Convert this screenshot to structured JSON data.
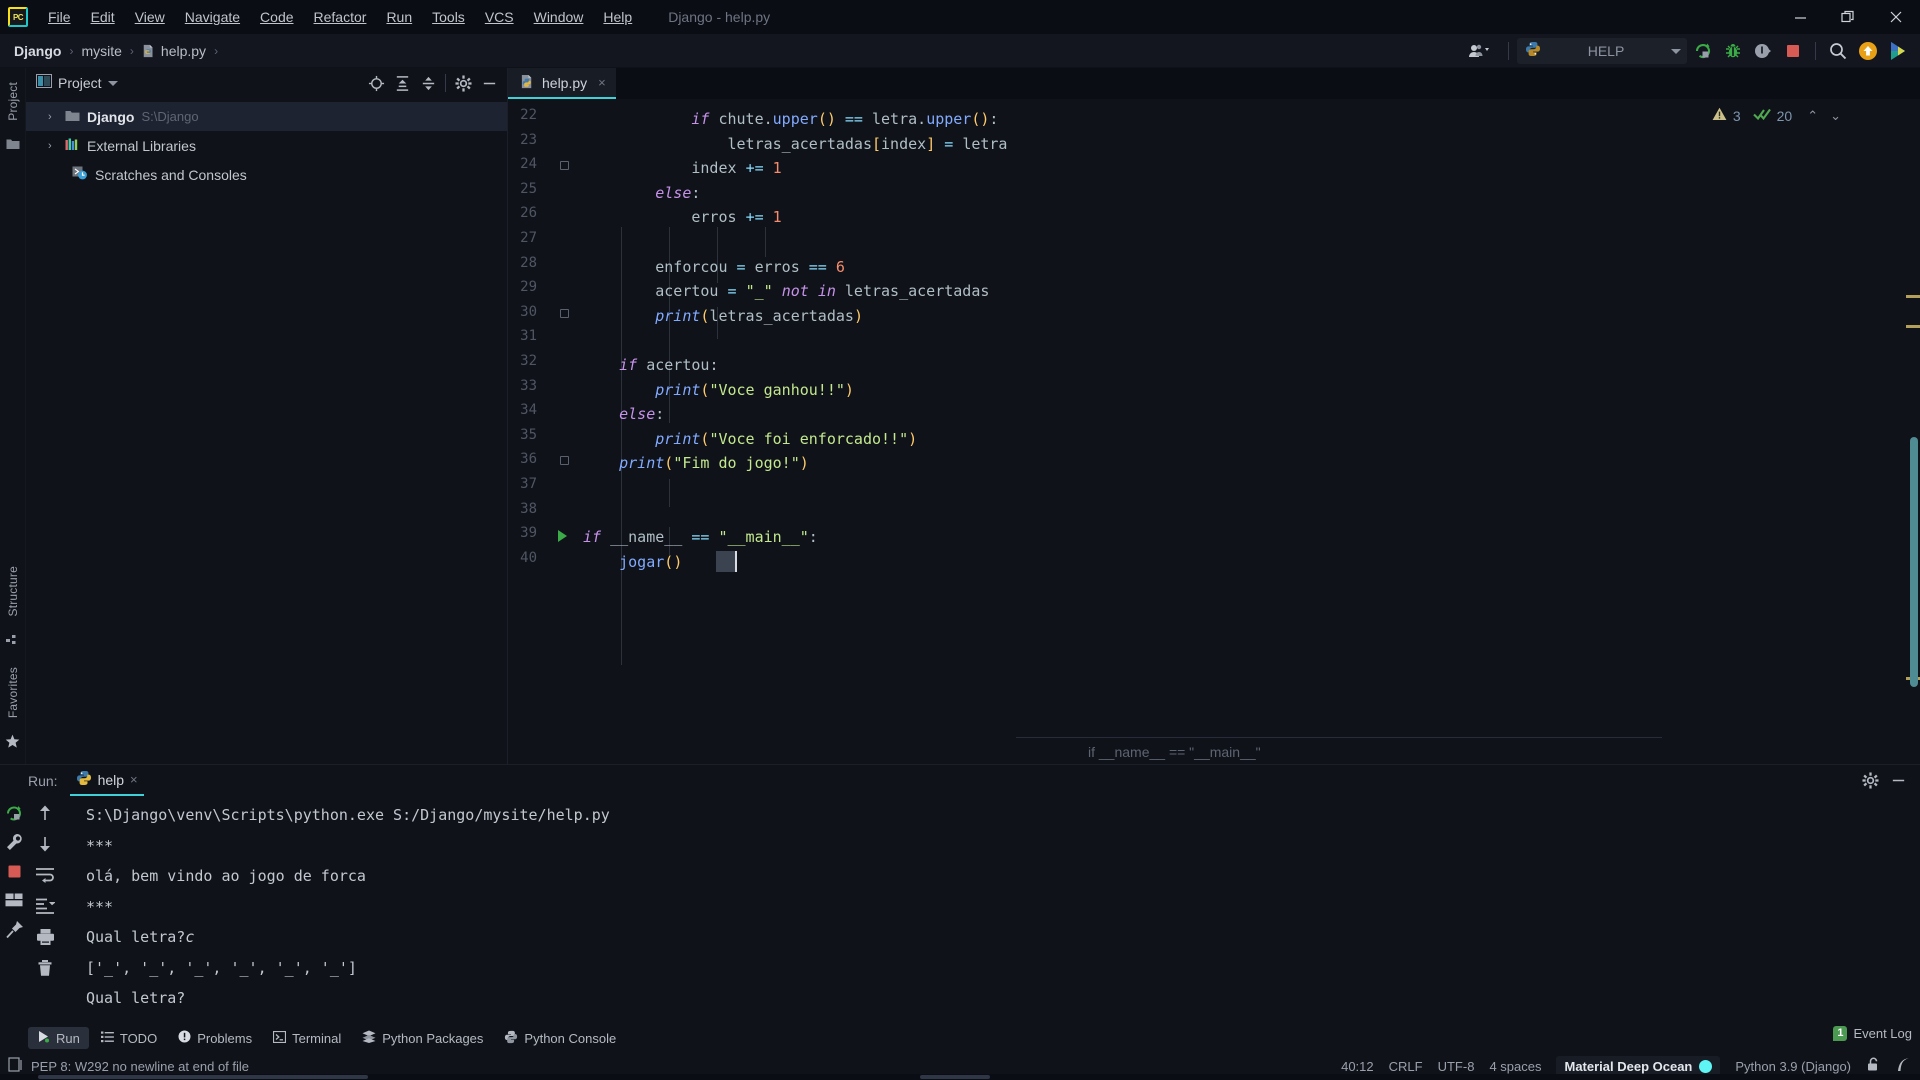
{
  "window": {
    "title": "Django - help.py",
    "controls": {
      "minimize": "minimize-icon",
      "restore": "restore-icon",
      "close": "close-icon"
    }
  },
  "menu": {
    "items": [
      {
        "label": "File"
      },
      {
        "label": "Edit"
      },
      {
        "label": "View"
      },
      {
        "label": "Navigate"
      },
      {
        "label": "Code"
      },
      {
        "label": "Refactor"
      },
      {
        "label": "Run"
      },
      {
        "label": "Tools"
      },
      {
        "label": "VCS"
      },
      {
        "label": "Window"
      },
      {
        "label": "Help"
      }
    ]
  },
  "navbar": {
    "breadcrumbs": [
      {
        "label": "Django",
        "icon": ""
      },
      {
        "label": "mysite",
        "icon": ""
      },
      {
        "label": "help.py",
        "icon": "python-file-icon"
      }
    ],
    "separator": "›",
    "run_config": {
      "label": "HELP",
      "icon": "python-icon"
    },
    "buttons": [
      {
        "name": "user-accounts-icon",
        "tip": "Accounts"
      },
      {
        "name": "run-button",
        "tip": "Run"
      },
      {
        "name": "debug-button",
        "tip": "Debug"
      },
      {
        "name": "run-with-coverage-button",
        "tip": "Run with Coverage"
      },
      {
        "name": "stop-button",
        "tip": "Stop"
      },
      {
        "name": "search-everywhere-icon",
        "tip": "Search Everywhere"
      },
      {
        "name": "update-project-icon",
        "tip": "Update"
      },
      {
        "name": "ide-assistant-icon",
        "tip": "Assistant"
      }
    ]
  },
  "project_panel": {
    "title": "Project",
    "toolbar_icons": [
      "locate-icon",
      "expand-all-icon",
      "collapse-all-icon",
      "gear-icon",
      "hide-icon"
    ],
    "tree": [
      {
        "label": "Django",
        "path": "S:\\Django",
        "arrow": "›",
        "icon": "folder-icon",
        "bold": true,
        "selected": true
      },
      {
        "label": "External Libraries",
        "path": "",
        "arrow": "›",
        "icon": "libraries-icon",
        "bold": false,
        "selected": false
      },
      {
        "label": "Scratches and Consoles",
        "path": "",
        "arrow": "",
        "icon": "scratches-icon",
        "bold": false,
        "selected": false
      }
    ]
  },
  "left_rail": {
    "labels": [
      "Project"
    ]
  },
  "bottom_left_rail": {
    "labels": [
      "Structure",
      "Favorites"
    ]
  },
  "editor": {
    "tab": {
      "label": "help.py",
      "close": "×",
      "icon": "python-file-icon"
    },
    "inspections": {
      "warning_count": "3",
      "ok_count": "20",
      "warning_icon": "warning-triangle-icon",
      "ok_icon": "double-check-icon",
      "prev": "⌃",
      "next": "⌄"
    },
    "bottom_breadcrumb": "if __name__ == \"__main__\"",
    "lines": [
      {
        "n": "22",
        "text": "            if chute.upper() == letra.upper():"
      },
      {
        "n": "23",
        "text": "                letras_acertadas[index] = letra"
      },
      {
        "n": "24",
        "text": "            index += 1"
      },
      {
        "n": "25",
        "text": "        else:"
      },
      {
        "n": "26",
        "text": "            erros += 1"
      },
      {
        "n": "27",
        "text": ""
      },
      {
        "n": "28",
        "text": "        enforcou = erros == 6"
      },
      {
        "n": "29",
        "text": "        acertou = \"_\" not in letras_acertadas"
      },
      {
        "n": "30",
        "text": "        print(letras_acertadas)"
      },
      {
        "n": "31",
        "text": ""
      },
      {
        "n": "32",
        "text": "    if acertou:"
      },
      {
        "n": "33",
        "text": "        print(\"Voce ganhou!!\")"
      },
      {
        "n": "34",
        "text": "    else:"
      },
      {
        "n": "35",
        "text": "        print(\"Voce foi enforcado!!\")"
      },
      {
        "n": "36",
        "text": "    print(\"Fim do jogo!\")"
      },
      {
        "n": "37",
        "text": ""
      },
      {
        "n": "38",
        "text": ""
      },
      {
        "n": "39",
        "text": "if __name__ == \"__main__\":"
      },
      {
        "n": "40",
        "text": "    jogar()"
      }
    ]
  },
  "run_panel": {
    "label": "Run:",
    "tab": {
      "label": "help",
      "close": "×",
      "icon": "python-icon"
    },
    "head_icons": [
      "gear-icon",
      "hide-icon"
    ],
    "left_tools": [
      "rerun-icon",
      "settings-wrench-icon",
      "stop-icon",
      "layout-icon",
      "pin-icon"
    ],
    "right_tools": [
      "up-arrow-icon",
      "down-arrow-icon",
      "soft-wrap-icon",
      "scroll-to-end-icon",
      "print-icon",
      "trash-icon"
    ],
    "console_lines": [
      {
        "text": "S:\\Django\\venv\\Scripts\\python.exe S:/Django/mysite/help.py",
        "input": ""
      },
      {
        "text": "***",
        "input": ""
      },
      {
        "text": "olá, bem vindo ao jogo de forca",
        "input": ""
      },
      {
        "text": "***",
        "input": ""
      },
      {
        "text": "Qual letra?",
        "input": "c"
      },
      {
        "text": "['_', '_', '_', '_', '_', '_']",
        "input": ""
      },
      {
        "text": "Qual letra?",
        "input": ""
      }
    ]
  },
  "tool_windows": [
    {
      "label": "Run",
      "icon": "run-icon",
      "active": true
    },
    {
      "label": "TODO",
      "icon": "todo-icon",
      "active": false
    },
    {
      "label": "Problems",
      "icon": "problems-icon",
      "active": false
    },
    {
      "label": "Terminal",
      "icon": "terminal-icon",
      "active": false
    },
    {
      "label": "Python Packages",
      "icon": "packages-icon",
      "active": false
    },
    {
      "label": "Python Console",
      "icon": "python-console-icon",
      "active": false
    }
  ],
  "status_bar": {
    "message": "PEP 8: W292 no newline at end of file",
    "message_icon": "inspection-icon",
    "caret_position": "40:12",
    "line_separator": "CRLF",
    "encoding": "UTF-8",
    "indent": "4 spaces",
    "color_scheme": "Material Deep Ocean",
    "interpreter": "Python 3.9 (Django)",
    "lock_icon": "unlocked-icon",
    "vcs_icon": "branch-icon",
    "event_log": {
      "label": "Event Log",
      "count": "1"
    }
  },
  "colors": {
    "accent_cyan": "#3fd0d8",
    "keyword_purple": "#c792ea",
    "string_green": "#c3e88d",
    "function_blue": "#82aaff",
    "number_orange": "#f78c6c",
    "operator_cyan": "#89ddff",
    "bracket_yellow": "#ffcb6b",
    "background": "#0f1219",
    "titlebar": "#0b0d14"
  }
}
